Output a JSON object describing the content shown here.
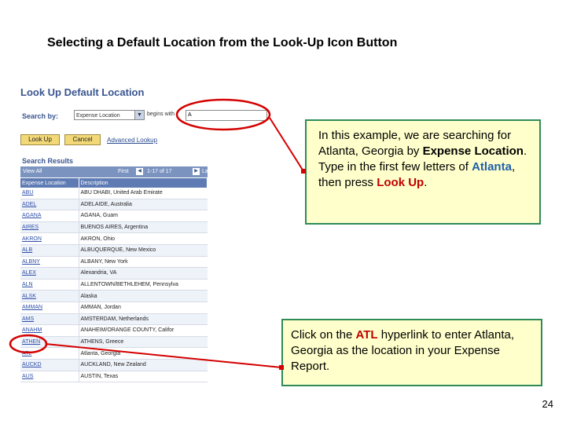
{
  "slide": {
    "title": "Selecting a Default Location from the Look-Up Icon Button",
    "page_number": "24"
  },
  "lookup": {
    "title": "Look Up Default Location",
    "search_by_label": "Search by:",
    "search_field": "Expense Location",
    "operator": "begins with",
    "search_value": "A",
    "lookup_button": "Look Up",
    "cancel_button": "Cancel",
    "advanced_lookup": "Advanced Lookup"
  },
  "results": {
    "label": "Search Results",
    "view_all": "View All",
    "first": "First",
    "range": "1-17 of 17",
    "last": "Last",
    "columns": [
      "Expense Location",
      "Description"
    ],
    "rows": [
      [
        "ABU",
        "ABU DHABI, United Arab Emirate"
      ],
      [
        "ADEL",
        "ADELAIDE, Australia"
      ],
      [
        "AGANA",
        "AGANA, Guam"
      ],
      [
        "AIRES",
        "BUENOS AIRES, Argentina"
      ],
      [
        "AKRON",
        "AKRON, Ohio"
      ],
      [
        "ALB",
        "ALBUQUERQUE, New Mexico"
      ],
      [
        "ALBNY",
        "ALBANY, New York"
      ],
      [
        "ALEX",
        "Alexandria, VA"
      ],
      [
        "ALN",
        "ALLENTOWN/BETHLEHEM, Pennsylva"
      ],
      [
        "ALSK",
        "Alaska"
      ],
      [
        "AMMAN",
        "AMMAN, Jordan"
      ],
      [
        "AMS",
        "AMSTERDAM, Netherlands"
      ],
      [
        "ANAHM",
        "ANAHEIM/ORANGE COUNTY, Califor"
      ],
      [
        "ATHEN",
        "ATHENS, Greece"
      ],
      [
        "ATL",
        "Atlanta, Georgia"
      ],
      [
        "AUCKD",
        "AUCKLAND, New Zealand"
      ],
      [
        "AUS",
        "AUSTIN, Texas"
      ]
    ]
  },
  "callout1": {
    "t1": "In this example, we are searching for Atlanta, Georgia by ",
    "t2": "Expense Location",
    "t3": ". Type in the first few letters of ",
    "t4": "Atlanta",
    "t5": ", then press ",
    "t6": "Look Up",
    "t7": "."
  },
  "callout2": {
    "t1": "Click on the ",
    "t2": "ATL",
    "t3": " hyperlink to enter Atlanta, Georgia as the location in your Expense Report."
  }
}
